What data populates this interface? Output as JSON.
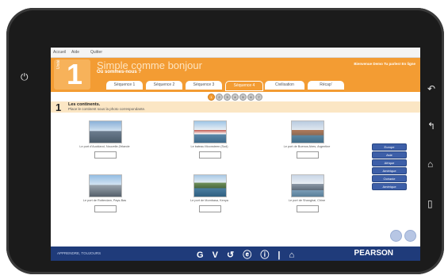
{
  "topbar": {
    "items": [
      "Accueil",
      "Aide",
      "Quitter"
    ]
  },
  "header": {
    "unit_label": "Unité",
    "unit_number": "1",
    "title": "Simple comme bonjour",
    "subtitle": "Où sommes-nous ?",
    "welcome": "Bienvenue Demo Tu parles! En ligne"
  },
  "tabs": [
    "Séquence 1",
    "Séquence 2",
    "Séquence 3",
    "Séquence 4",
    "Civilisation",
    "Récap'"
  ],
  "active_tab": "Séquence 4",
  "pager": [
    "1",
    "2",
    "3",
    "4",
    "5",
    "6",
    "7"
  ],
  "exercise": {
    "number": "1",
    "title": "Les continents.",
    "instruction": "Place le continent sous la photo correspondante."
  },
  "photos": [
    {
      "caption": "Le port d'Auckland, Nouvelle-Zélande"
    },
    {
      "caption": "Le bateau Moonsteen (Sud)"
    },
    {
      "caption": "Le port de Buenos Aires, Argentine"
    },
    {
      "caption": "Le port de Rotterdam, Pays-Bas"
    },
    {
      "caption": "Le port de Mombasa, Kenya"
    },
    {
      "caption": "Le port de Shanghai, Chine"
    }
  ],
  "continents": [
    "Europe",
    "Asie",
    "Afrique",
    "Amérique",
    "Océanie",
    "Amérique"
  ],
  "footer": {
    "left_text": "APPRENDRE, TOUJOURS",
    "icons": "G V ↺ ⓔ ⓘ | ⌂",
    "brand": "PEARSON"
  },
  "colors": {
    "accent": "#f39c33",
    "footer": "#1f3b7a",
    "continent_button": "#3d5fa8"
  }
}
